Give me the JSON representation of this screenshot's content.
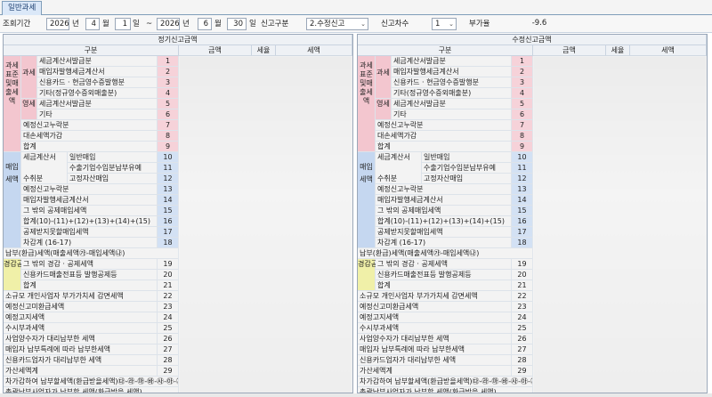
{
  "tab": {
    "label": "일반과세"
  },
  "toolbar": {
    "period_label": "조회기간",
    "start_year": "2026",
    "year_unit": "년",
    "start_month": "4",
    "month_unit": "월",
    "start_day": "1",
    "day_unit": "일",
    "tilde": "~",
    "end_year": "2026",
    "end_month": "6",
    "end_day": "30",
    "filing_type_label": "신고구분",
    "filing_type_value": "2.수정신고",
    "filing_seq_label": "신고차수",
    "filing_seq_value": "1",
    "vat_rate_label": "부가율",
    "vat_rate_value": "-9.6"
  },
  "left_panel": {
    "title": "정기신고금액",
    "col_category": "구분",
    "col_amount": "금액",
    "col_rate": "세율",
    "col_tax": "세액"
  },
  "right_panel": {
    "title": "수정신고금액",
    "col_category": "구분",
    "col_amount": "금액",
    "col_rate": "세율",
    "col_tax": "세액"
  },
  "groups": {
    "tax_base": "과세표준및매출세액",
    "taxable": "과세",
    "zero_rate": "영세",
    "purchase": "매입세액",
    "receipt": "수취분",
    "tax_invoice": "세금계산서",
    "reduction": "경감공제세액"
  },
  "rows": {
    "r1": "세금계산서발급분",
    "r2": "매입자발행세금계산서",
    "r3": "신용카드 · 현금영수증발행분",
    "r4": "기타(정규영수증외매출분)",
    "r5": "세금계산서발급분",
    "r6": "기타",
    "r7": "예정신고누락분",
    "r8": "대손세액가감",
    "r9": "합계",
    "r10": "일반매입",
    "r11": "수출기업수입분납부유예",
    "r12": "고정자산매입",
    "r13": "예정신고누락분",
    "r14": "매입자발행세금계산서",
    "r15": "그 밖의 공제매입세액",
    "r16": "합계(10)-(11)+(12)+(13)+(14)+(15)",
    "r17": "공제받지못할매입세액",
    "r18": "차감계 (16-17)",
    "payable": "납부(환급)세액(매출세액㉮-매입세액㉯)",
    "r19": "그 밖의 경감 · 공제세액",
    "r20": "신용카드매출전표등 발행공제등",
    "r21": "합계",
    "r22": "소규모 개인사업자 부가가치세 감면세액",
    "r23": "예정신고미환급세액",
    "r24": "예정고지세액",
    "r25": "수시부과세액",
    "r26": "사업양수자가 대리납부한 세액",
    "r27": "매입자 납부특례에 따라 납부한세액",
    "r28": "신용카드업자가 대리납부한 세액",
    "r29": "가산세액계",
    "r_final": "차가감하여 납부할세액(환급받을세액)㉰-㉱-㉲-㉳-㉴-㉵-㉶+㉷",
    "r_total": "총괄납부사업자가 납부할 세액(환급받을 세액)"
  },
  "nums": [
    "1",
    "2",
    "3",
    "4",
    "5",
    "6",
    "7",
    "8",
    "9",
    "10",
    "11",
    "12",
    "13",
    "14",
    "15",
    "16",
    "17",
    "18",
    "19",
    "20",
    "21",
    "22",
    "23",
    "24",
    "25",
    "26",
    "27",
    "28",
    "29"
  ]
}
